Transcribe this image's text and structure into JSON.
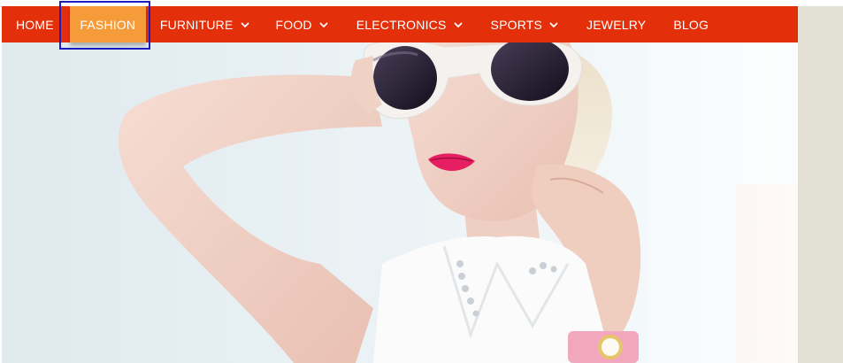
{
  "nav": {
    "items": [
      {
        "label": "HOME",
        "has_dropdown": false,
        "active": false
      },
      {
        "label": "FASHION",
        "has_dropdown": false,
        "active": true
      },
      {
        "label": "FURNITURE",
        "has_dropdown": true,
        "active": false
      },
      {
        "label": "FOOD",
        "has_dropdown": true,
        "active": false
      },
      {
        "label": "ELECTRONICS",
        "has_dropdown": true,
        "active": false
      },
      {
        "label": "SPORTS",
        "has_dropdown": true,
        "active": false
      },
      {
        "label": "JEWELRY",
        "has_dropdown": false,
        "active": false
      },
      {
        "label": "BLOG",
        "has_dropdown": false,
        "active": false
      }
    ]
  },
  "colors": {
    "nav_background": "#e4300a",
    "nav_active": "#f59b3a",
    "nav_text": "#ffffff",
    "focus_outline": "#1c1cc4",
    "side_panel": "#e3e1d6"
  },
  "hero": {
    "image": "fashion-model-sunglasses-banner"
  }
}
